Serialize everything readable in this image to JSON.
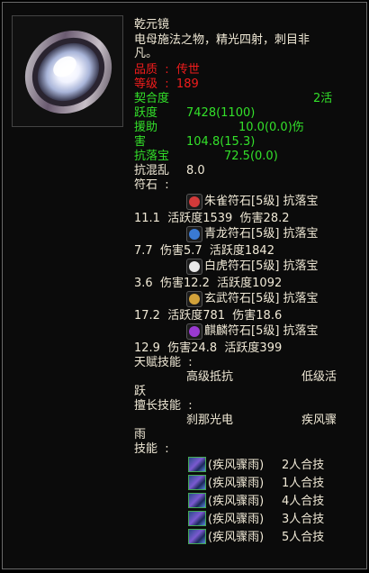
{
  "item": {
    "name": "乾元镜",
    "desc_line1": "电母施法之物，精光四射，刺目非",
    "desc_line2": "凡。",
    "quality_label": "品质  :  ",
    "quality_value": "传世",
    "level_label": "等级  :  ",
    "level_value": "189"
  },
  "stats": {
    "r1a": "契合度",
    "r1b": "2活",
    "r2a": "跃度",
    "r2b": "7428(1100)",
    "r3a": "援助",
    "r3b": "10.0(0.0)伤",
    "r4a": "害",
    "r4b": "104.8(15.3)",
    "r5a": "抗落宝",
    "r5b": "72.5(0.0)",
    "r6a": "抗混乱",
    "r6b": "8.0"
  },
  "runes": {
    "header": "符石  :",
    "list": [
      {
        "title": "朱雀符石[5级] 抗落宝",
        "line2": "11.1  活跃度1539  伤害28.2",
        "icon": "zhuque-rune-icon",
        "color": "#d23a3a"
      },
      {
        "title": "青龙符石[5级] 抗落宝",
        "line2": "7.7  伤害5.7  活跃度1842",
        "icon": "qinglong-rune-icon",
        "color": "#3a7ad2"
      },
      {
        "title": "白虎符石[5级] 抗落宝",
        "line2": "3.6  伤害12.2  活跃度1092",
        "icon": "baihu-rune-icon",
        "color": "#e8e8e8"
      },
      {
        "title": "玄武符石[5级] 抗落宝",
        "line2": "17.2  活跃度781  伤害18.6",
        "icon": "xuanwu-rune-icon",
        "color": "#d2a23a"
      },
      {
        "title": "麒麟符石[5级] 抗落宝",
        "line2": "12.9  伤害24.8  活跃度399",
        "icon": "qilin-rune-icon",
        "color": "#9a3ad2"
      }
    ]
  },
  "talent": {
    "header": "天赋技能  :",
    "a": "高级抵抗",
    "b": "低级活",
    "c": "跃"
  },
  "specialty": {
    "header": "擅长技能  :",
    "a": "刹那光电",
    "b": "疾风骤",
    "c": "雨"
  },
  "skills": {
    "header": "技能  :",
    "list": [
      {
        "name": "(疾风骤雨)",
        "combo": "2人合技"
      },
      {
        "name": "(疾风骤雨)",
        "combo": "1人合技"
      },
      {
        "name": "(疾风骤雨)",
        "combo": "4人合技"
      },
      {
        "name": "(疾风骤雨)",
        "combo": "3人合技"
      },
      {
        "name": "(疾风骤雨)",
        "combo": "5人合技"
      }
    ]
  }
}
